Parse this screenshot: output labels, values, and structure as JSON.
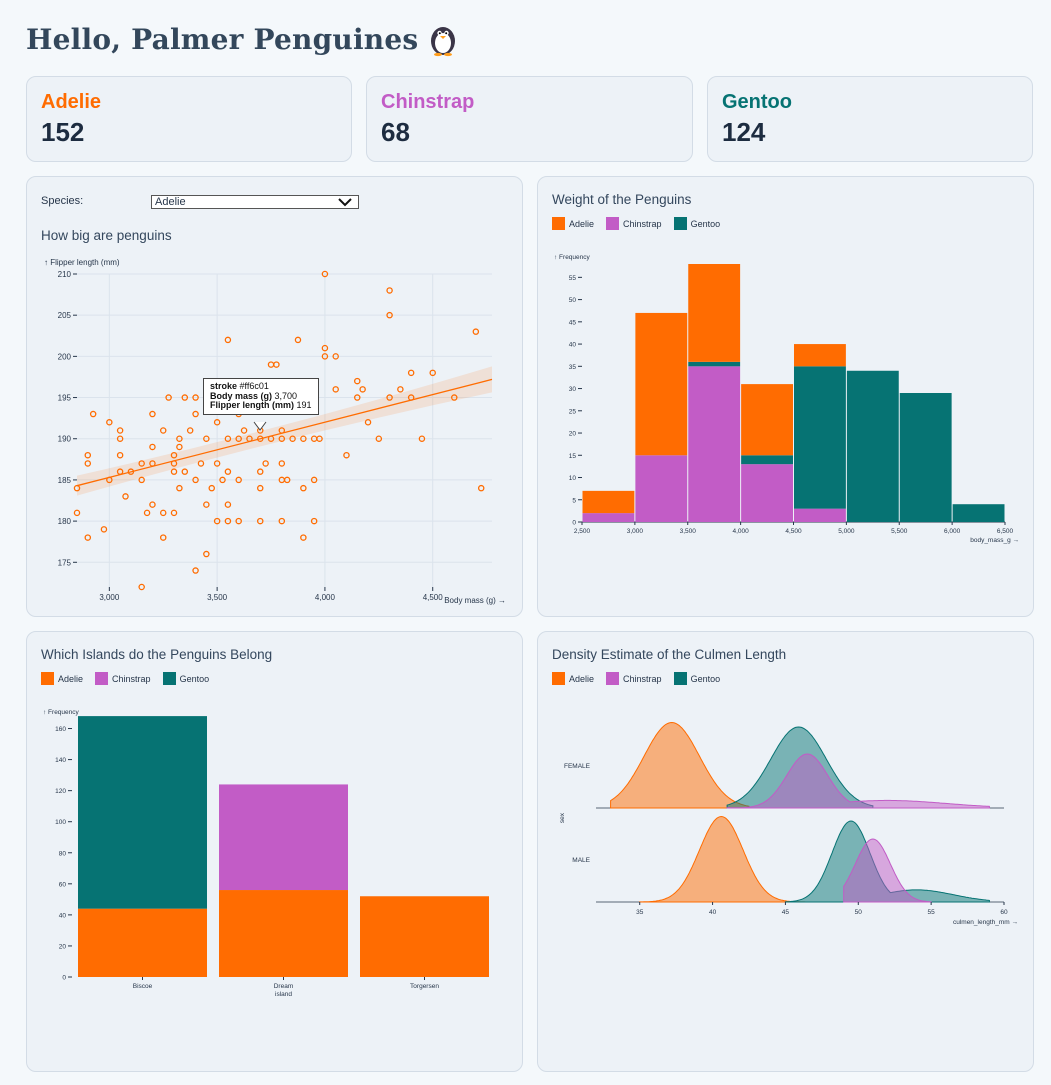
{
  "header": {
    "title": "Hello, Palmer Penguines"
  },
  "colors": {
    "adelie": "#ff6c01",
    "chinstrap": "#c25cc6",
    "gentoo": "#067373"
  },
  "stats": [
    {
      "name": "Adelie",
      "count": "152"
    },
    {
      "name": "Chinstrap",
      "count": "68"
    },
    {
      "name": "Gentoo",
      "count": "124"
    }
  ],
  "scatter": {
    "species_label": "Species:",
    "species_value": "Adelie",
    "title": "How big are penguins",
    "tooltip": {
      "line1_label": "stroke",
      "line1_value": "#ff6c01",
      "line2_label": "Body mass (g)",
      "line2_value": "3,700",
      "line3_label": "Flipper length (mm)",
      "line3_value": "191"
    }
  },
  "legend": {
    "adelie": "Adelie",
    "chinstrap": "Chinstrap",
    "gentoo": "Gentoo"
  },
  "weight": {
    "title": "Weight of the Penguins"
  },
  "islands": {
    "title": "Which Islands do the Penguins Belong"
  },
  "density": {
    "title": "Density Estimate of the Culmen Length"
  },
  "chart_data": [
    {
      "type": "scatter",
      "title": "How big are penguins",
      "xlabel": "Body mass (g) →",
      "ylabel": "↑ Flipper length (mm)",
      "xlim": [
        2850,
        4775
      ],
      "ylim": [
        172,
        210
      ],
      "x_ticks": [
        "3,000",
        "3,500",
        "4,000",
        "4,500"
      ],
      "y_ticks": [
        "175",
        "180",
        "185",
        "190",
        "195",
        "200",
        "205",
        "210"
      ],
      "series": [
        {
          "name": "Adelie",
          "points": [
            [
              2850,
              181
            ],
            [
              2850,
              184
            ],
            [
              2900,
              178
            ],
            [
              2900,
              187
            ],
            [
              2900,
              188
            ],
            [
              2925,
              193
            ],
            [
              2975,
              179
            ],
            [
              3000,
              185
            ],
            [
              3000,
              192
            ],
            [
              3050,
              186
            ],
            [
              3050,
              188
            ],
            [
              3050,
              190
            ],
            [
              3050,
              191
            ],
            [
              3075,
              183
            ],
            [
              3100,
              186
            ],
            [
              3150,
              172
            ],
            [
              3150,
              185
            ],
            [
              3150,
              187
            ],
            [
              3175,
              181
            ],
            [
              3200,
              182
            ],
            [
              3200,
              187
            ],
            [
              3200,
              189
            ],
            [
              3200,
              193
            ],
            [
              3250,
              178
            ],
            [
              3250,
              181
            ],
            [
              3250,
              191
            ],
            [
              3275,
              195
            ],
            [
              3300,
              181
            ],
            [
              3300,
              186
            ],
            [
              3300,
              187
            ],
            [
              3300,
              188
            ],
            [
              3325,
              184
            ],
            [
              3325,
              189
            ],
            [
              3325,
              190
            ],
            [
              3350,
              186
            ],
            [
              3350,
              195
            ],
            [
              3375,
              191
            ],
            [
              3400,
              174
            ],
            [
              3400,
              185
            ],
            [
              3400,
              193
            ],
            [
              3400,
              195
            ],
            [
              3425,
              187
            ],
            [
              3450,
              176
            ],
            [
              3450,
              182
            ],
            [
              3450,
              190
            ],
            [
              3475,
              184
            ],
            [
              3500,
              180
            ],
            [
              3500,
              187
            ],
            [
              3500,
              192
            ],
            [
              3525,
              185
            ],
            [
              3550,
              180
            ],
            [
              3550,
              182
            ],
            [
              3550,
              186
            ],
            [
              3550,
              190
            ],
            [
              3550,
              195
            ],
            [
              3550,
              202
            ],
            [
              3600,
              180
            ],
            [
              3600,
              185
            ],
            [
              3600,
              190
            ],
            [
              3600,
              193
            ],
            [
              3625,
              191
            ],
            [
              3650,
              190
            ],
            [
              3650,
              195
            ],
            [
              3700,
              180
            ],
            [
              3700,
              184
            ],
            [
              3700,
              186
            ],
            [
              3700,
              190
            ],
            [
              3700,
              191
            ],
            [
              3725,
              187
            ],
            [
              3750,
              190
            ],
            [
              3750,
              195
            ],
            [
              3750,
              199
            ],
            [
              3775,
              199
            ],
            [
              3800,
              180
            ],
            [
              3800,
              185
            ],
            [
              3800,
              187
            ],
            [
              3800,
              190
            ],
            [
              3800,
              191
            ],
            [
              3825,
              185
            ],
            [
              3850,
              190
            ],
            [
              3875,
              202
            ],
            [
              3900,
              178
            ],
            [
              3900,
              184
            ],
            [
              3900,
              190
            ],
            [
              3950,
              180
            ],
            [
              3950,
              185
            ],
            [
              3950,
              190
            ],
            [
              3975,
              190
            ],
            [
              4000,
              200
            ],
            [
              4000,
              201
            ],
            [
              4000,
              210
            ],
            [
              4050,
              200
            ],
            [
              4050,
              196
            ],
            [
              4100,
              188
            ],
            [
              4150,
              195
            ],
            [
              4150,
              197
            ],
            [
              4175,
              196
            ],
            [
              4200,
              192
            ],
            [
              4250,
              190
            ],
            [
              4300,
              195
            ],
            [
              4300,
              205
            ],
            [
              4300,
              208
            ],
            [
              4350,
              196
            ],
            [
              4400,
              195
            ],
            [
              4400,
              198
            ],
            [
              4450,
              190
            ],
            [
              4500,
              198
            ],
            [
              4600,
              195
            ],
            [
              4700,
              203
            ],
            [
              4725,
              184
            ]
          ]
        }
      ],
      "trend": {
        "x": [
          2850,
          4775
        ],
        "y": [
          184.3,
          197.2
        ]
      }
    },
    {
      "type": "bar",
      "title": "Weight of the Penguins",
      "ylabel": "↑ Frequency",
      "xlabel": "body_mass_g →",
      "xlim": [
        2500,
        6500
      ],
      "ylim": [
        0,
        58
      ],
      "x_ticks": [
        "2,500",
        "3,000",
        "3,500",
        "4,000",
        "4,500",
        "5,000",
        "5,500",
        "6,000",
        "6,500"
      ],
      "y_ticks": [
        "0",
        "5",
        "10",
        "15",
        "20",
        "25",
        "30",
        "35",
        "40",
        "45",
        "50",
        "55"
      ],
      "bins": [
        [
          2500,
          3000
        ],
        [
          3000,
          3500
        ],
        [
          3500,
          4000
        ],
        [
          4000,
          4500
        ],
        [
          4500,
          5000
        ],
        [
          5000,
          5500
        ],
        [
          5500,
          6000
        ],
        [
          6000,
          6500
        ]
      ],
      "series": [
        {
          "name": "Chinstrap",
          "values": [
            2,
            15,
            35,
            13,
            3,
            0,
            0,
            0
          ]
        },
        {
          "name": "Gentoo",
          "values": [
            0,
            0,
            1,
            2,
            32,
            34,
            29,
            4
          ]
        },
        {
          "name": "Adelie",
          "values": [
            5,
            32,
            22,
            16,
            5,
            0,
            0,
            0
          ]
        }
      ]
    },
    {
      "type": "bar",
      "title": "Which Islands do the Penguins Belong",
      "ylabel": "↑ Frequency",
      "ylim": [
        0,
        170
      ],
      "categories": [
        "Biscoe",
        "Dream island",
        "Torgersen"
      ],
      "y_ticks": [
        "0",
        "20",
        "40",
        "60",
        "80",
        "100",
        "120",
        "140",
        "160"
      ],
      "series": [
        {
          "name": "Adelie",
          "values": [
            44,
            56,
            52
          ]
        },
        {
          "name": "Chinstrap",
          "values": [
            0,
            68,
            0
          ]
        },
        {
          "name": "Gentoo",
          "values": [
            124,
            0,
            0
          ]
        }
      ]
    },
    {
      "type": "area",
      "title": "Density Estimate of the Culmen Length",
      "xlabel": "culmen_length_mm →",
      "ylabel": "sex",
      "rows": [
        "FEMALE",
        "MALE"
      ],
      "xlim": [
        32,
        60
      ],
      "x_ticks": [
        "35",
        "40",
        "45",
        "50",
        "55",
        "60"
      ],
      "series": [
        {
          "name": "Adelie",
          "row": "FEMALE",
          "peak": 37.2,
          "sd": 1.9,
          "range": [
            33,
            42.5
          ]
        },
        {
          "name": "Gentoo",
          "row": "FEMALE",
          "peak": 45.9,
          "sd": 1.9,
          "range": [
            41,
            51
          ]
        },
        {
          "name": "Chinstrap",
          "row": "FEMALE",
          "peak": 46.5,
          "sd": 1.4,
          "range": [
            41,
            59
          ]
        },
        {
          "name": "Adelie",
          "row": "MALE",
          "peak": 40.6,
          "sd": 1.5,
          "range": [
            35,
            47
          ]
        },
        {
          "name": "Gentoo",
          "row": "MALE",
          "peak": 49.5,
          "sd": 1.3,
          "range": [
            45,
            59
          ]
        },
        {
          "name": "Chinstrap",
          "row": "MALE",
          "peak": 51.0,
          "sd": 1.2,
          "range": [
            49,
            55
          ]
        }
      ]
    }
  ]
}
